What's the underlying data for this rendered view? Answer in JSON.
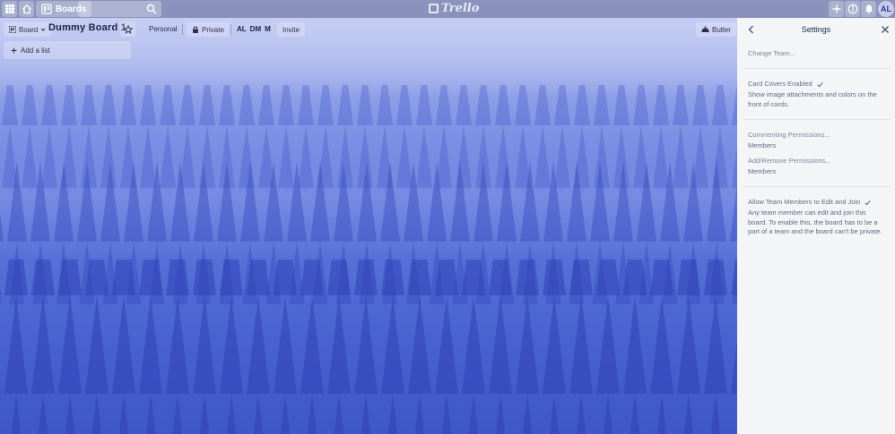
{
  "topbar": {
    "boards_label": "Boards",
    "logo_text": "Trello",
    "avatar_initials": "AL"
  },
  "board": {
    "view_label": "Board",
    "title": "Dummy Board 1",
    "team_label": "Personal",
    "visibility_label": "Private",
    "members": [
      "AL",
      "DM",
      "M"
    ],
    "invite_label": "Invite",
    "butler_label": "Butler",
    "add_list_label": "Add a list"
  },
  "settings": {
    "title": "Settings",
    "change_team": "Change Team...",
    "card_covers_label": "Card Covers Enabled",
    "card_covers_desc": "Show image attachments and colors on the front of cards.",
    "commenting_label": "Commenting Permissions...",
    "commenting_value": "Members",
    "add_remove_label": "Add/Remove Permissions...",
    "add_remove_value": "Members",
    "allow_team_label": "Allow Team Members to Edit and Join",
    "allow_team_desc": "Any team member can edit and join this board. To enable this, the board has to be a part of a team and the board can't be private."
  },
  "colors": {
    "panel_bg": "#f4f5f7",
    "accent_blue": "#5670d8"
  }
}
